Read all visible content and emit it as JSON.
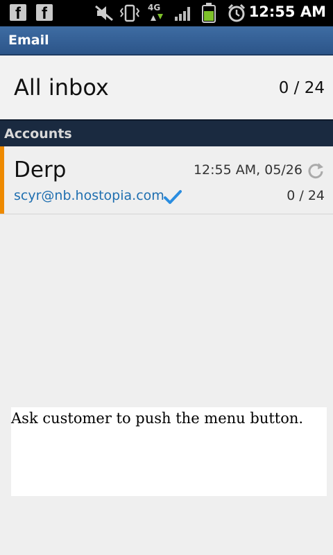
{
  "status_bar": {
    "icons": [
      "facebook-icon",
      "facebook-icon",
      "mute-icon",
      "vibrate-icon",
      "4g-icon",
      "signal-icon",
      "battery-icon",
      "alarm-icon"
    ],
    "fb_letter": "f",
    "network": "4G",
    "time": "12:55 AM"
  },
  "app": {
    "title": "Email"
  },
  "all_inbox": {
    "label": "All inbox",
    "count": "0 / 24"
  },
  "accounts_header": "Accounts",
  "accounts": [
    {
      "name": "Derp",
      "last_sync": "12:55 AM, 05/26",
      "email": "scyr@nb.hostopia.com",
      "count": "0 / 24",
      "accent_color": "#ee8a00"
    }
  ],
  "note": "Ask customer to push the menu button.",
  "colors": {
    "title_bar": "#3e6ca3",
    "section_header": "#1a2a40",
    "email_link": "#1f6fb0",
    "accent": "#ee8a00"
  }
}
